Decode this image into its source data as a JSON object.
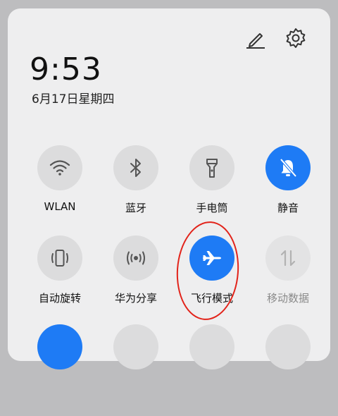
{
  "status": {
    "time": "9:53",
    "date": "6月17日星期四"
  },
  "toolbar": {
    "edit_icon": "pencil-icon",
    "settings_icon": "gear-icon"
  },
  "tiles": [
    {
      "label": "WLAN",
      "icon": "wifi-icon",
      "state": "off"
    },
    {
      "label": "蓝牙",
      "icon": "bluetooth-icon",
      "state": "off"
    },
    {
      "label": "手电筒",
      "icon": "flashlight-icon",
      "state": "off"
    },
    {
      "label": "静音",
      "icon": "bell-muted-icon",
      "state": "on"
    },
    {
      "label": "自动旋转",
      "icon": "auto-rotate-icon",
      "state": "off"
    },
    {
      "label": "华为分享",
      "icon": "huawei-share-icon",
      "state": "off"
    },
    {
      "label": "飞行模式",
      "icon": "airplane-icon",
      "state": "on"
    },
    {
      "label": "移动数据",
      "icon": "mobile-data-icon",
      "state": "disabled"
    }
  ],
  "colors": {
    "active": "#1e7bf5",
    "inactive": "#dcdcdd",
    "annotation": "#e2231a"
  }
}
